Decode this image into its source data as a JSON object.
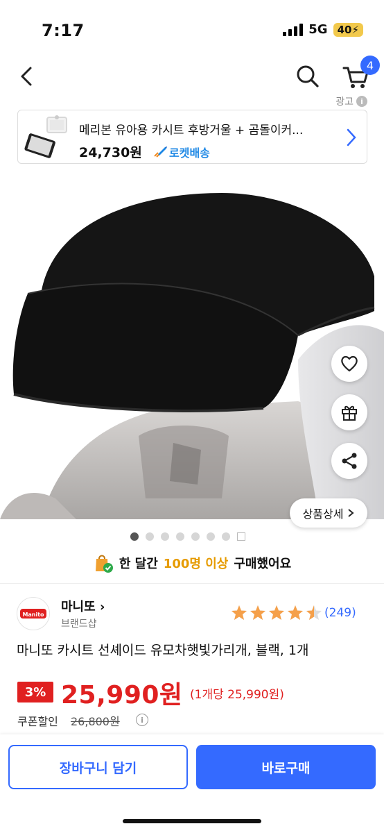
{
  "status_bar": {
    "time": "7:17",
    "network": "5G",
    "battery": "40"
  },
  "nav": {
    "cart_count": "4"
  },
  "ad": {
    "tag": "광고",
    "title": "메리본 유아용 카시트 후방거울 + 곰돌이커...",
    "price": "24,730원",
    "shipping": "로켓배송"
  },
  "detail_button": {
    "label": "상품상세"
  },
  "carousel": {
    "total": 7,
    "active_index": 0
  },
  "purchase_banner": {
    "prefix": "한 달간",
    "highlight": "100명 이상",
    "suffix": "구매했어요"
  },
  "brand": {
    "name": "마니또",
    "sub": "브랜드샵",
    "logo_text": "Manito"
  },
  "rating": {
    "stars": 4.5,
    "count": "(249)"
  },
  "product": {
    "title": "마니또 카시트 선셰이드 유모차햇빛가리개, 블랙, 1개"
  },
  "price": {
    "discount": "3%",
    "sale": "25,990원",
    "unit": "(1개당 25,990원)",
    "coupon_label": "쿠폰할인",
    "original": "26,800원"
  },
  "actions": {
    "add_to_cart": "장바구니 담기",
    "buy_now": "바로구매"
  },
  "colors": {
    "accent": "#346aff",
    "sale": "#e02020",
    "highlight": "#e69b00",
    "star": "#f5a04a"
  }
}
